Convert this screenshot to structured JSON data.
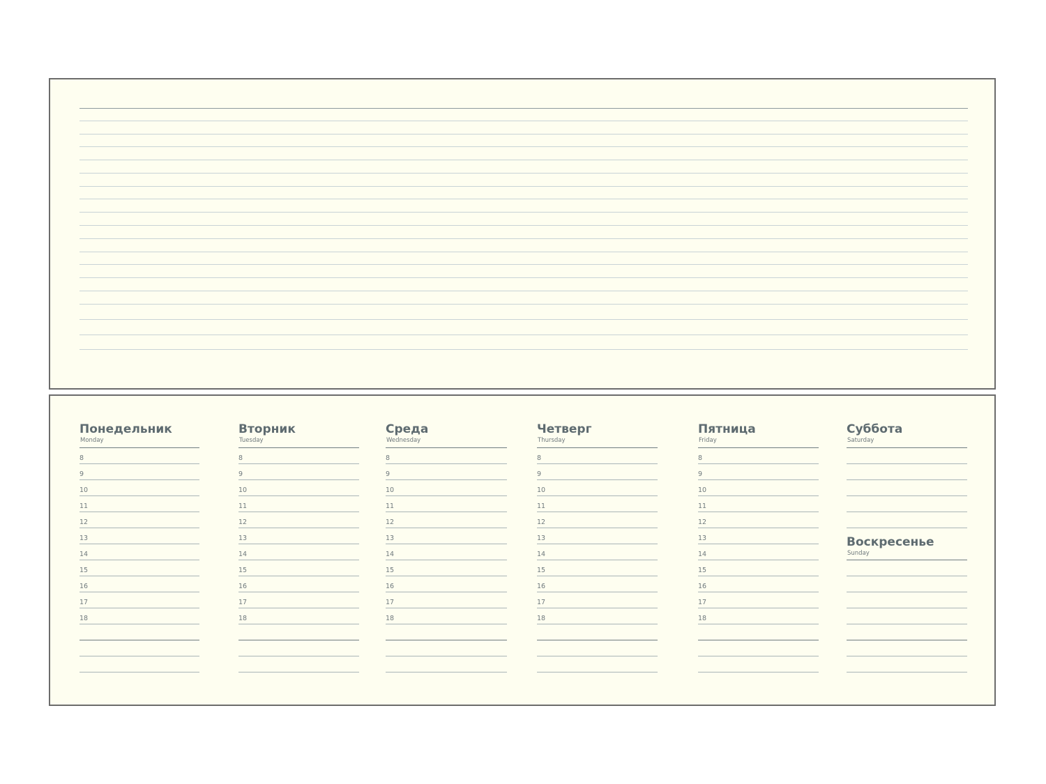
{
  "notes": {
    "line_count": 19
  },
  "hours": [
    "8",
    "9",
    "10",
    "11",
    "12",
    "13",
    "14",
    "15",
    "16",
    "17",
    "18"
  ],
  "weekdays": [
    {
      "id": "monday",
      "title": "Понедельник",
      "subtitle": "Monday"
    },
    {
      "id": "tuesday",
      "title": "Вторник",
      "subtitle": "Tuesday"
    },
    {
      "id": "wednesday",
      "title": "Среда",
      "subtitle": "Wednesday"
    },
    {
      "id": "thursday",
      "title": "Четверг",
      "subtitle": "Thursday"
    },
    {
      "id": "friday",
      "title": "Пятница",
      "subtitle": "Friday"
    }
  ],
  "weekend": {
    "saturday": {
      "title": "Суббота",
      "subtitle": "Saturday"
    },
    "sunday": {
      "title": "Воскресенье",
      "subtitle": "Sunday"
    }
  },
  "colors": {
    "paper": "#fefef0",
    "border": "#6b6b6b",
    "text": "#5e6b70",
    "rule": "#a9b4b7"
  }
}
